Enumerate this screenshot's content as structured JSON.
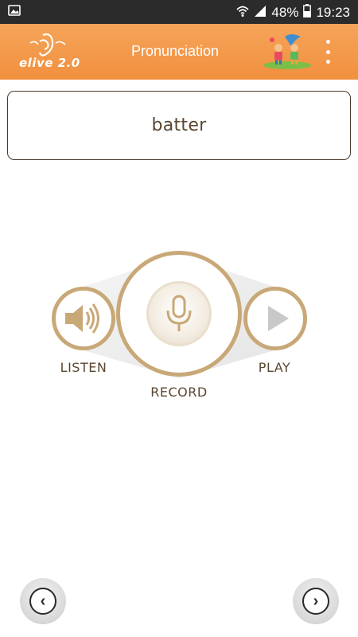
{
  "status_bar": {
    "battery": "48%",
    "time": "19:23",
    "icons": [
      "image-icon",
      "wifi-icon",
      "signal-icon",
      "battery-icon"
    ]
  },
  "app_bar": {
    "logo_text": "elive 2.0",
    "title": "Pronunciation",
    "menu_icon": "more-vert-icon"
  },
  "word": "batter",
  "controls": {
    "listen_label": "LISTEN",
    "record_label": "RECORD",
    "play_label": "PLAY"
  },
  "nav": {
    "prev_icon": "chevron-left-icon",
    "next_icon": "chevron-right-icon",
    "prev_glyph": "‹",
    "next_glyph": "›"
  },
  "colors": {
    "app_bar": "#f39a4b",
    "accent_tan": "#c9a877",
    "text_brown": "#5a4632",
    "status_bar": "#2b2b2b"
  }
}
